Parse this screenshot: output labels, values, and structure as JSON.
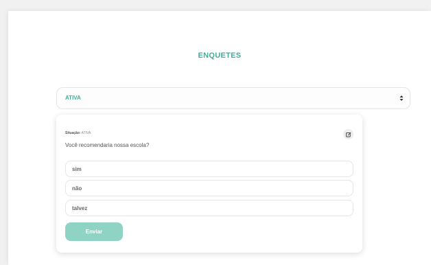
{
  "header": {
    "title": "ENQUETES"
  },
  "filter": {
    "selected": "ATIVA"
  },
  "poll": {
    "status_label": "Situação:",
    "status_value": "ATIVA",
    "question": "Você recomendaria nossa escola?",
    "options": [
      "sim",
      "não",
      "talvez"
    ],
    "submit_label": "Enviar"
  },
  "icons": {
    "edit": "edit-icon",
    "select_arrows": "sort-arrows-icon"
  },
  "colors": {
    "accent": "#3fae98",
    "button": "#8fd3c5",
    "background": "#f1f1f1"
  }
}
